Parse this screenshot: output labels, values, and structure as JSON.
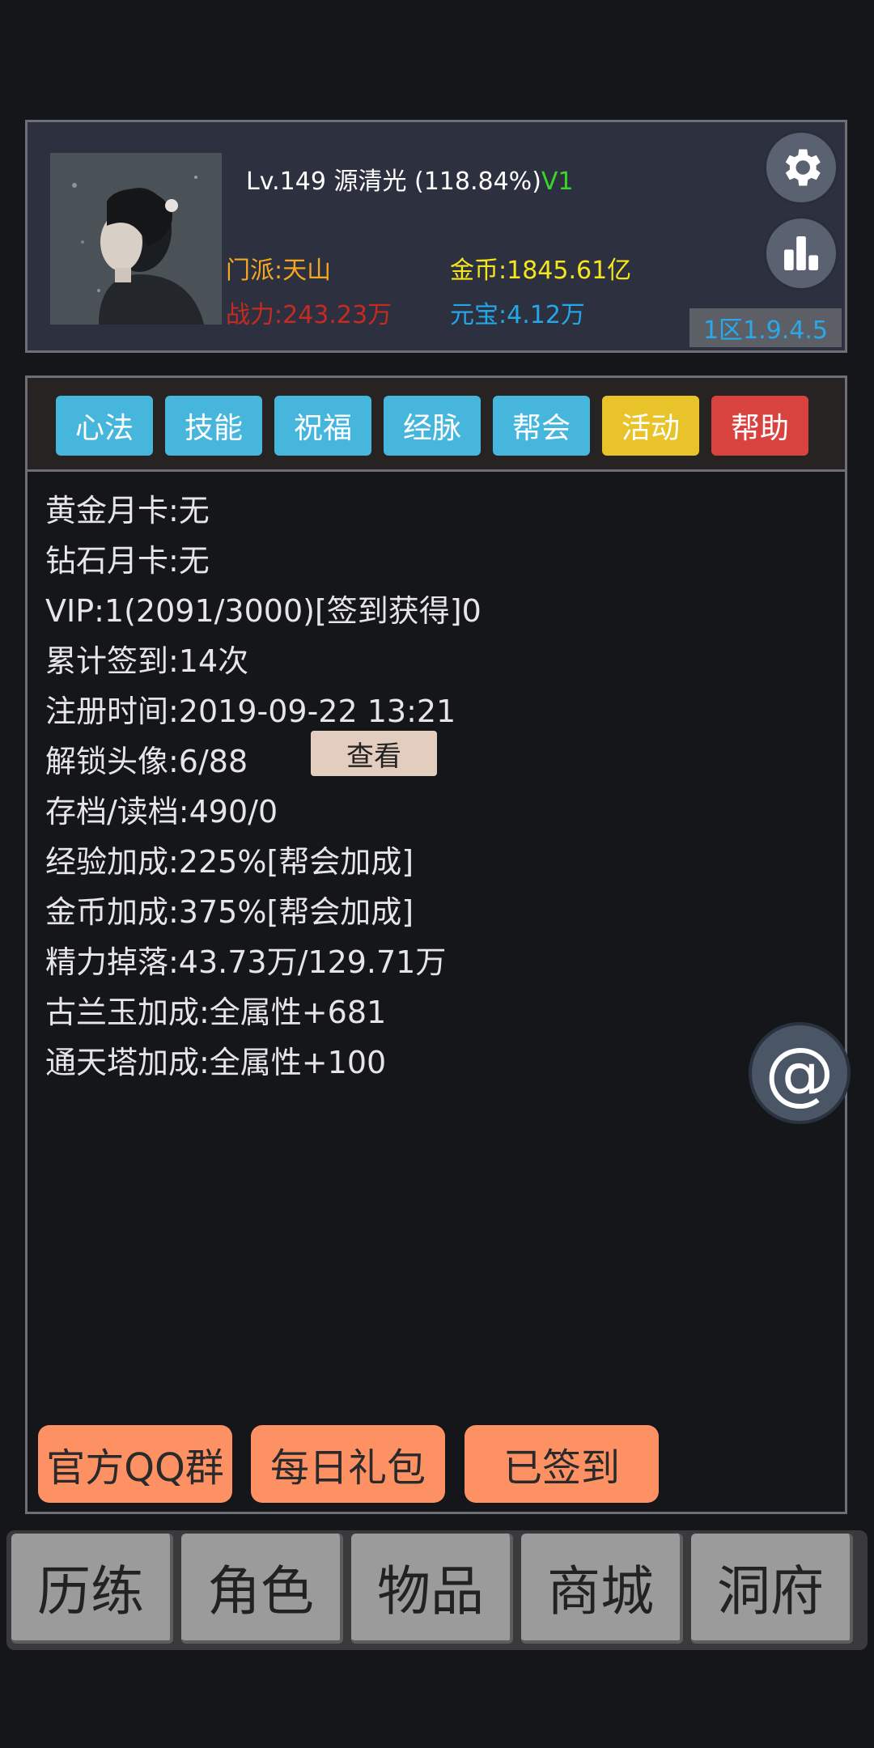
{
  "profile": {
    "name_text": "Lv.149 源清光 (118.84%)",
    "vip_tag": "V1",
    "sect": "门派:天山",
    "power": "战力:243.23万",
    "gold": "金币:1845.61亿",
    "ingot": "元宝:4.12万",
    "server_version": "1区1.9.4.5",
    "icons": {
      "settings": "gear-icon",
      "stats": "bar-chart-icon"
    },
    "colors": {
      "sect": "#f5a623",
      "power": "#c62a20",
      "gold": "#f5e61e",
      "ingot": "#22a8e8",
      "vip": "#3bd52b"
    }
  },
  "tabs": [
    {
      "label": "心法",
      "color": "blue"
    },
    {
      "label": "技能",
      "color": "blue"
    },
    {
      "label": "祝福",
      "color": "blue"
    },
    {
      "label": "经脉",
      "color": "blue"
    },
    {
      "label": "帮会",
      "color": "blue"
    },
    {
      "label": "活动",
      "color": "yellow"
    },
    {
      "label": "帮助",
      "color": "red"
    }
  ],
  "info": [
    "黄金月卡:无",
    "钻石月卡:无",
    "VIP:1(2091/3000)[签到获得]0",
    "累计签到:14次",
    "注册时间:2019-09-22 13:21",
    "解锁头像:6/88",
    "存档/读档:490/0",
    "经验加成:225%[帮会加成]",
    "金币加成:375%[帮会加成]",
    "精力掉落:43.73万/129.71万",
    "古兰玉加成:全属性+681",
    "通天塔加成:全属性+100"
  ],
  "view_button": "查看",
  "actions": {
    "qq_group": "官方QQ群",
    "daily_gift": "每日礼包",
    "checked_in": "已签到"
  },
  "floating": {
    "symbol": "@",
    "icon": "at-icon"
  },
  "nav": [
    "历练",
    "角色",
    "物品",
    "商城",
    "洞府"
  ]
}
